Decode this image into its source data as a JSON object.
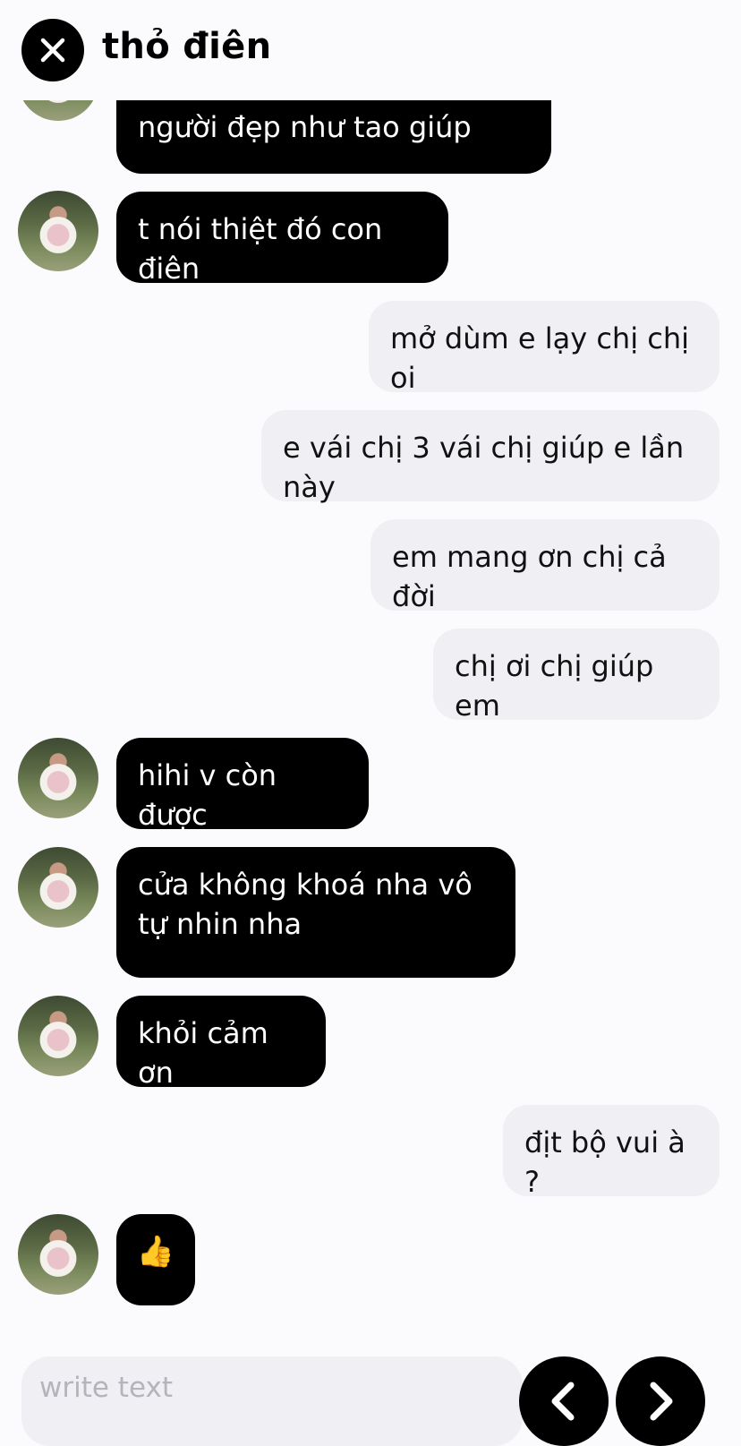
{
  "header": {
    "title": "thỏ điên"
  },
  "messages": [
    {
      "side": "in",
      "text": "người đẹp như tao giúp",
      "avatar": true
    },
    {
      "side": "in",
      "text": "t nói thiệt đó con điên",
      "avatar": true
    },
    {
      "side": "out",
      "text": "mở dùm e lạy chị chị oi"
    },
    {
      "side": "out",
      "text": "e vái chị 3 vái chị giúp e lần này"
    },
    {
      "side": "out",
      "text": "em mang ơn chị cả đời"
    },
    {
      "side": "out",
      "text": "chị ơi chị giúp em"
    },
    {
      "side": "in",
      "text": "hihi v còn được",
      "avatar": true
    },
    {
      "side": "in",
      "text": "cửa không khoá nha vô tự nhin nha",
      "avatar": true
    },
    {
      "side": "in",
      "text": "khỏi cảm ơn",
      "avatar": true
    },
    {
      "side": "out",
      "text": "địt bộ vui à ?"
    },
    {
      "side": "in",
      "text": "👍",
      "avatar": true
    }
  ],
  "composer": {
    "placeholder": "write text"
  },
  "icons": {
    "close": "close-icon",
    "prev": "chevron-left-icon",
    "next": "chevron-right-icon"
  }
}
